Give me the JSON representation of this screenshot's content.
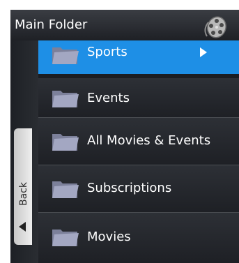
{
  "header": {
    "title": "Main Folder",
    "icon": "film-reel-icon"
  },
  "sidebar": {
    "back_label": "Back",
    "arrow_icon": "left-arrow-icon"
  },
  "menu": {
    "items": [
      {
        "label": "Sports",
        "icon": "folder-icon",
        "selected": true
      },
      {
        "label": "Events",
        "icon": "folder-icon"
      },
      {
        "label": "All Movies & Events",
        "icon": "folder-icon"
      },
      {
        "label": "Subscriptions",
        "icon": "folder-icon"
      },
      {
        "label": "Movies",
        "icon": "folder-icon"
      }
    ]
  },
  "colors": {
    "accent": "#1e8fe6",
    "background": "#1b1d22",
    "back_tab": "#dcdcdc"
  }
}
